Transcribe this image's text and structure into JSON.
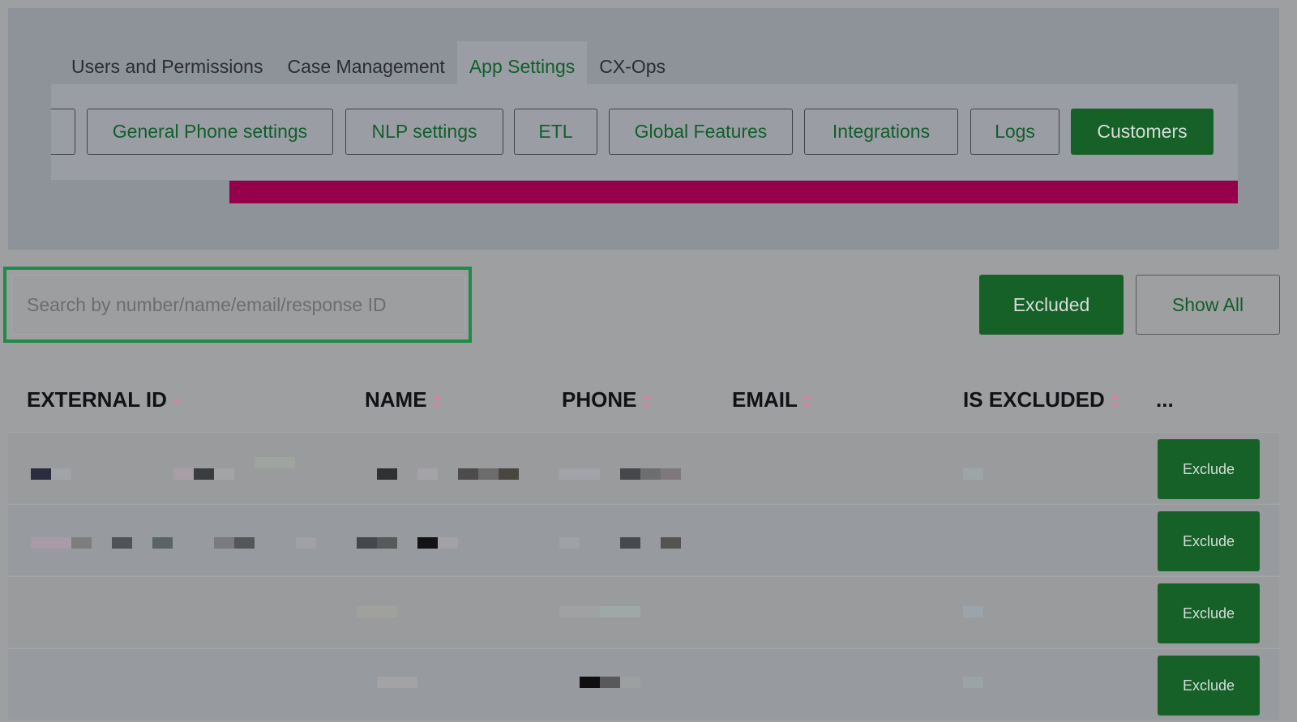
{
  "tabs": [
    {
      "label": "Users and Permissions",
      "active": false
    },
    {
      "label": "Case Management",
      "active": false
    },
    {
      "label": "App Settings",
      "active": true
    },
    {
      "label": "CX-Ops",
      "active": false
    }
  ],
  "settings_nav": [
    {
      "label": "General Phone settings",
      "active": false
    },
    {
      "label": "NLP settings",
      "active": false
    },
    {
      "label": "ETL",
      "active": false
    },
    {
      "label": "Global Features",
      "active": false
    },
    {
      "label": "Integrations",
      "active": false
    },
    {
      "label": "Logs",
      "active": false
    },
    {
      "label": "Customers",
      "active": true
    }
  ],
  "search": {
    "placeholder": "Search by number/name/email/response ID",
    "value": ""
  },
  "filters": {
    "excluded_label": "Excluded",
    "show_all_label": "Show All"
  },
  "table": {
    "columns": [
      "EXTERNAL ID",
      "NAME",
      "PHONE",
      "EMAIL",
      "IS EXCLUDED",
      "..."
    ],
    "sorted_column": "EXTERNAL ID",
    "sort_direction": "descending",
    "row_action_label": "Exclude",
    "row_count": 4
  },
  "colors": {
    "accent_green": "#156128",
    "sort_arrow": "#c58aa3",
    "highlight_border": "#1f8b47",
    "banner_magenta": "#96004b"
  }
}
